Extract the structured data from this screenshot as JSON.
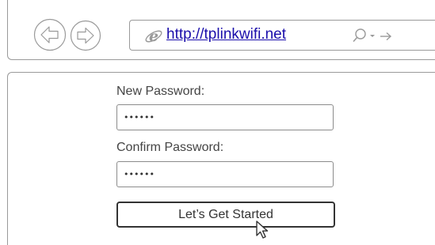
{
  "browser": {
    "url": "http://tplinkwifi.net",
    "back_icon": "back-arrow-icon",
    "forward_icon": "forward-arrow-icon",
    "browser_icon": "internet-explorer-icon",
    "search_icon": "search-icon",
    "dropdown_icon": "chevron-down-icon",
    "go_icon": "arrow-right-icon"
  },
  "form": {
    "new_password_label": "New Password:",
    "new_password_value": "••••••",
    "confirm_password_label": "Confirm Password:",
    "confirm_password_value": "••••••",
    "submit_label": "Let’s Get Started"
  },
  "colors": {
    "link": "#1a0dab",
    "border": "#9a9a9a",
    "ie_blue": "#3b8fd8"
  }
}
